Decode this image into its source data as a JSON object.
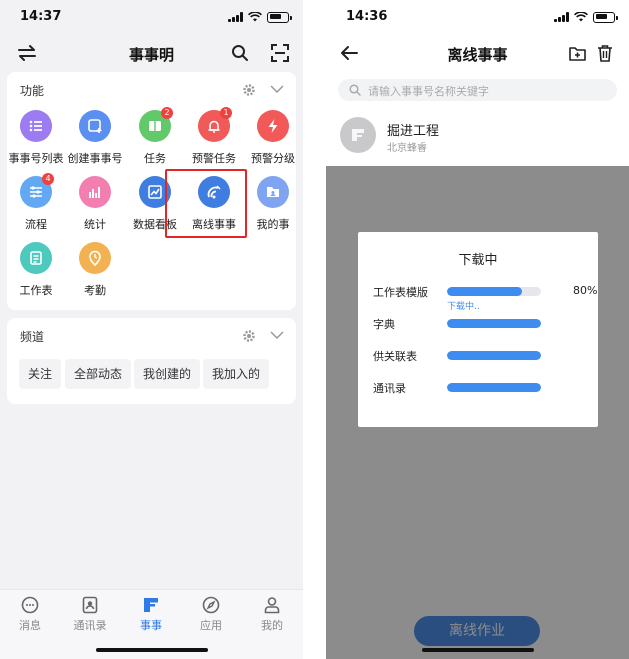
{
  "left": {
    "status": {
      "time": "14:37"
    },
    "nav": {
      "title": "事事明"
    },
    "functions": {
      "title": "功能",
      "apps": [
        {
          "label": "事事号列表",
          "icon": "list-icon",
          "color": "#9b7cf1",
          "badge": ""
        },
        {
          "label": "创建事事号",
          "icon": "create-icon",
          "color": "#5b8ff2",
          "badge": ""
        },
        {
          "label": "任务",
          "icon": "task-icon",
          "color": "#62c96a",
          "badge": "2"
        },
        {
          "label": "预警任务",
          "icon": "alarm-bell-icon",
          "color": "#f25a5a",
          "badge": "1"
        },
        {
          "label": "预警分级",
          "icon": "lightning-icon",
          "color": "#f25a5a",
          "badge": ""
        },
        {
          "label": "流程",
          "icon": "flow-icon",
          "color": "#62a8f2",
          "badge": "4"
        },
        {
          "label": "统计",
          "icon": "statistics-icon",
          "color": "#f27fb0",
          "badge": ""
        },
        {
          "label": "数据看板",
          "icon": "data-board-icon",
          "color": "#3f7ee0",
          "badge": ""
        },
        {
          "label": "离线事事",
          "icon": "offline-icon",
          "color": "#3f7ee0",
          "badge": ""
        },
        {
          "label": "我的事",
          "icon": "my-items-icon",
          "color": "#7fa4f2",
          "badge": ""
        },
        {
          "label": "工作表",
          "icon": "worksheet-icon",
          "color": "#4ec9bd",
          "badge": ""
        },
        {
          "label": "考勤",
          "icon": "attendance-icon",
          "color": "#f2b252",
          "badge": ""
        }
      ]
    },
    "channels": {
      "title": "频道",
      "chips": [
        "关注",
        "全部动态",
        "我创建的",
        "我加入的"
      ]
    },
    "tabs": [
      {
        "label": "消息",
        "icon": "message-icon",
        "active": false
      },
      {
        "label": "通讯录",
        "icon": "contacts-icon",
        "active": false
      },
      {
        "label": "事事",
        "icon": "shishi-icon",
        "active": true
      },
      {
        "label": "应用",
        "icon": "compass-icon",
        "active": false
      },
      {
        "label": "我的",
        "icon": "profile-icon",
        "active": false
      }
    ]
  },
  "right": {
    "status": {
      "time": "14:36"
    },
    "nav": {
      "title": "离线事事"
    },
    "search": {
      "placeholder": "请输入事事号名称关键字"
    },
    "project": {
      "name": "掘进工程",
      "subtitle": "北京蜂睿"
    },
    "dialog": {
      "title": "下载中",
      "rows": [
        {
          "label": "工作表模版",
          "progress": 0.8,
          "percent": "80%",
          "sub": "下载中.."
        },
        {
          "label": "字典",
          "progress": 1.0,
          "percent": "",
          "sub": ""
        },
        {
          "label": "供关联表",
          "progress": 1.0,
          "percent": "",
          "sub": ""
        },
        {
          "label": "通讯录",
          "progress": 1.0,
          "percent": "",
          "sub": ""
        }
      ]
    },
    "bottom_button": "离线作业"
  },
  "colors": {
    "accent": "#2f7ae5",
    "highlight": "#e22626"
  }
}
